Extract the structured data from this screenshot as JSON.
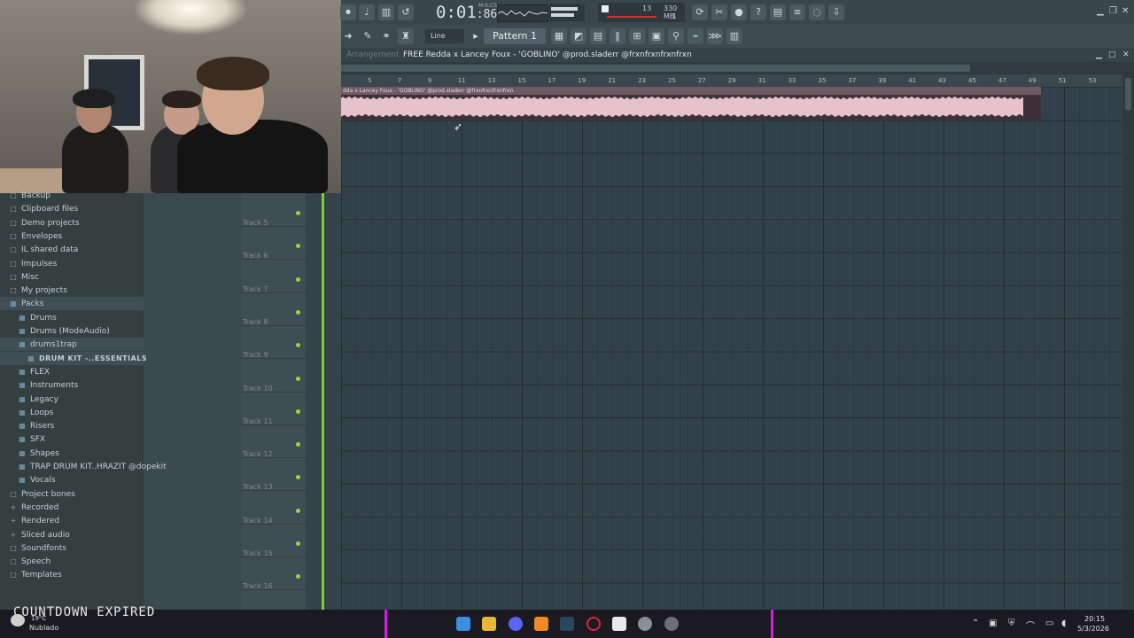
{
  "toolbar": {
    "time": "0:01",
    "time_fraction": "86",
    "time_unit": "M:S:CS",
    "cpu_value": "13",
    "memory": "330 MB",
    "memory_sub": "1",
    "snap_label": "Line",
    "pattern_label": "Pattern 1"
  },
  "playlist": {
    "window_section": "Arrangement",
    "window_title": "FREE  Redda x Lancey Foux - 'GOBLINO'  @prod.sladerr @frxnfrxnfrxnfrxn",
    "clip_label": "dda x Lancey Foux - 'GOBLINO'  @prod.sladerr @frxnfrxnfrxnfrxn",
    "ruler_ticks": [
      "5",
      "7",
      "9",
      "11",
      "13",
      "15",
      "17",
      "19",
      "21",
      "23",
      "25",
      "27",
      "29",
      "31",
      "33",
      "35",
      "37",
      "39",
      "41",
      "43",
      "45",
      "47",
      "49",
      "51",
      "53"
    ],
    "tracks": [
      "Track 5",
      "Track 6",
      "Track 7",
      "Track 8",
      "Track 9",
      "Track 10",
      "Track 11",
      "Track 12",
      "Track 13",
      "Track 14",
      "Track 15",
      "Track 16"
    ]
  },
  "browser": {
    "items": [
      {
        "label": "Backup",
        "icon": "folder-icon",
        "indent": 0,
        "selected": false
      },
      {
        "label": "Clipboard files",
        "icon": "folder-icon",
        "indent": 0,
        "selected": false
      },
      {
        "label": "Demo projects",
        "icon": "folder-icon",
        "indent": 0,
        "selected": false
      },
      {
        "label": "Envelopes",
        "icon": "folder-icon",
        "indent": 0,
        "selected": false
      },
      {
        "label": "IL shared data",
        "icon": "folder-icon",
        "indent": 0,
        "selected": false
      },
      {
        "label": "Impulses",
        "icon": "folder-icon",
        "indent": 0,
        "selected": false
      },
      {
        "label": "Misc",
        "icon": "folder-icon",
        "indent": 0,
        "selected": false
      },
      {
        "label": "My projects",
        "icon": "folder-icon",
        "indent": 0,
        "selected": false
      },
      {
        "label": "Packs",
        "icon": "pack-icon",
        "indent": 0,
        "selected": true
      },
      {
        "label": "Drums",
        "icon": "pack-icon",
        "indent": 1,
        "selected": false
      },
      {
        "label": "Drums (ModeAudio)",
        "icon": "pack-icon",
        "indent": 1,
        "selected": false
      },
      {
        "label": "drums1trap",
        "icon": "pack-icon",
        "indent": 1,
        "selected": true
      },
      {
        "label": "DRUM KIT -..ESSENTIALS",
        "icon": "pack-icon",
        "indent": 2,
        "selected": true
      },
      {
        "label": "FLEX",
        "icon": "pack-icon",
        "indent": 1,
        "selected": false
      },
      {
        "label": "Instruments",
        "icon": "pack-icon",
        "indent": 1,
        "selected": false
      },
      {
        "label": "Legacy",
        "icon": "pack-icon",
        "indent": 1,
        "selected": false
      },
      {
        "label": "Loops",
        "icon": "pack-icon",
        "indent": 1,
        "selected": false
      },
      {
        "label": "Risers",
        "icon": "pack-icon",
        "indent": 1,
        "selected": false
      },
      {
        "label": "SFX",
        "icon": "pack-icon",
        "indent": 1,
        "selected": false
      },
      {
        "label": "Shapes",
        "icon": "pack-icon",
        "indent": 1,
        "selected": false
      },
      {
        "label": "TRAP DRUM KIT..HRAZIT @dopekit",
        "icon": "pack-icon",
        "indent": 1,
        "selected": false
      },
      {
        "label": "Vocals",
        "icon": "pack-icon",
        "indent": 1,
        "selected": false
      },
      {
        "label": "Project bones",
        "icon": "folder-icon",
        "indent": 0,
        "selected": false
      },
      {
        "label": "Recorded",
        "icon": "plus-icon",
        "indent": 0,
        "selected": false
      },
      {
        "label": "Rendered",
        "icon": "plus-icon",
        "indent": 0,
        "selected": false
      },
      {
        "label": "Sliced audio",
        "icon": "plus-icon",
        "indent": 0,
        "selected": false
      },
      {
        "label": "Soundfonts",
        "icon": "folder-icon",
        "indent": 0,
        "selected": false
      },
      {
        "label": "Speech",
        "icon": "folder-icon",
        "indent": 0,
        "selected": false
      },
      {
        "label": "Templates",
        "icon": "folder-icon",
        "indent": 0,
        "selected": false
      }
    ]
  },
  "overlay": {
    "countdown_text": "COUNTDOWN EXPIRED"
  },
  "taskbar": {
    "weather_temp": "19°C",
    "weather_status": "Nublado",
    "time": "20:15",
    "date": "5/3/2026"
  },
  "colors": {
    "accent_green": "#9fd23b",
    "clip_pink": "#e7c2cc",
    "stream_border": "#d11ee0"
  }
}
